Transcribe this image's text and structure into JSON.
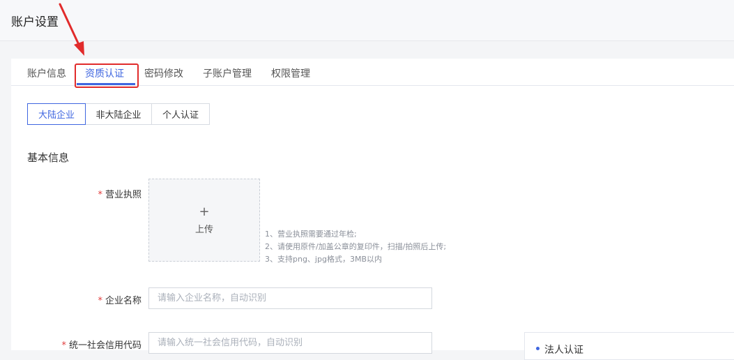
{
  "page": {
    "title": "账户设置"
  },
  "tabs": [
    {
      "label": "账户信息",
      "active": false
    },
    {
      "label": "资质认证",
      "active": true
    },
    {
      "label": "密码修改",
      "active": false
    },
    {
      "label": "子账户管理",
      "active": false
    },
    {
      "label": "权限管理",
      "active": false
    }
  ],
  "entity_types": [
    {
      "label": "大陆企业",
      "active": true
    },
    {
      "label": "非大陆企业",
      "active": false
    },
    {
      "label": "个人认证",
      "active": false
    }
  ],
  "form": {
    "section_title": "基本信息",
    "required_mark": "*",
    "license": {
      "label": "营业执照",
      "upload_plus": "+",
      "upload_label": "上传",
      "hints": [
        "1、营业执照需要通过年检;",
        "2、请使用原件/加盖公章的复印件，扫描/拍照后上传;",
        "3、支持png、jpg格式，3MB以内"
      ]
    },
    "company_name": {
      "label": "企业名称",
      "value": "",
      "placeholder": "请输入企业名称，自动识别"
    },
    "credit_code": {
      "label": "统一社会信用代码",
      "value": "",
      "placeholder": "请输入统一社会信用代码，自动识别"
    }
  },
  "side_panel": {
    "item_label": "法人认证"
  },
  "annotation": {
    "color": "#e12b2b"
  },
  "colors": {
    "accent": "#3f66e0",
    "required": "#e13c3c"
  }
}
